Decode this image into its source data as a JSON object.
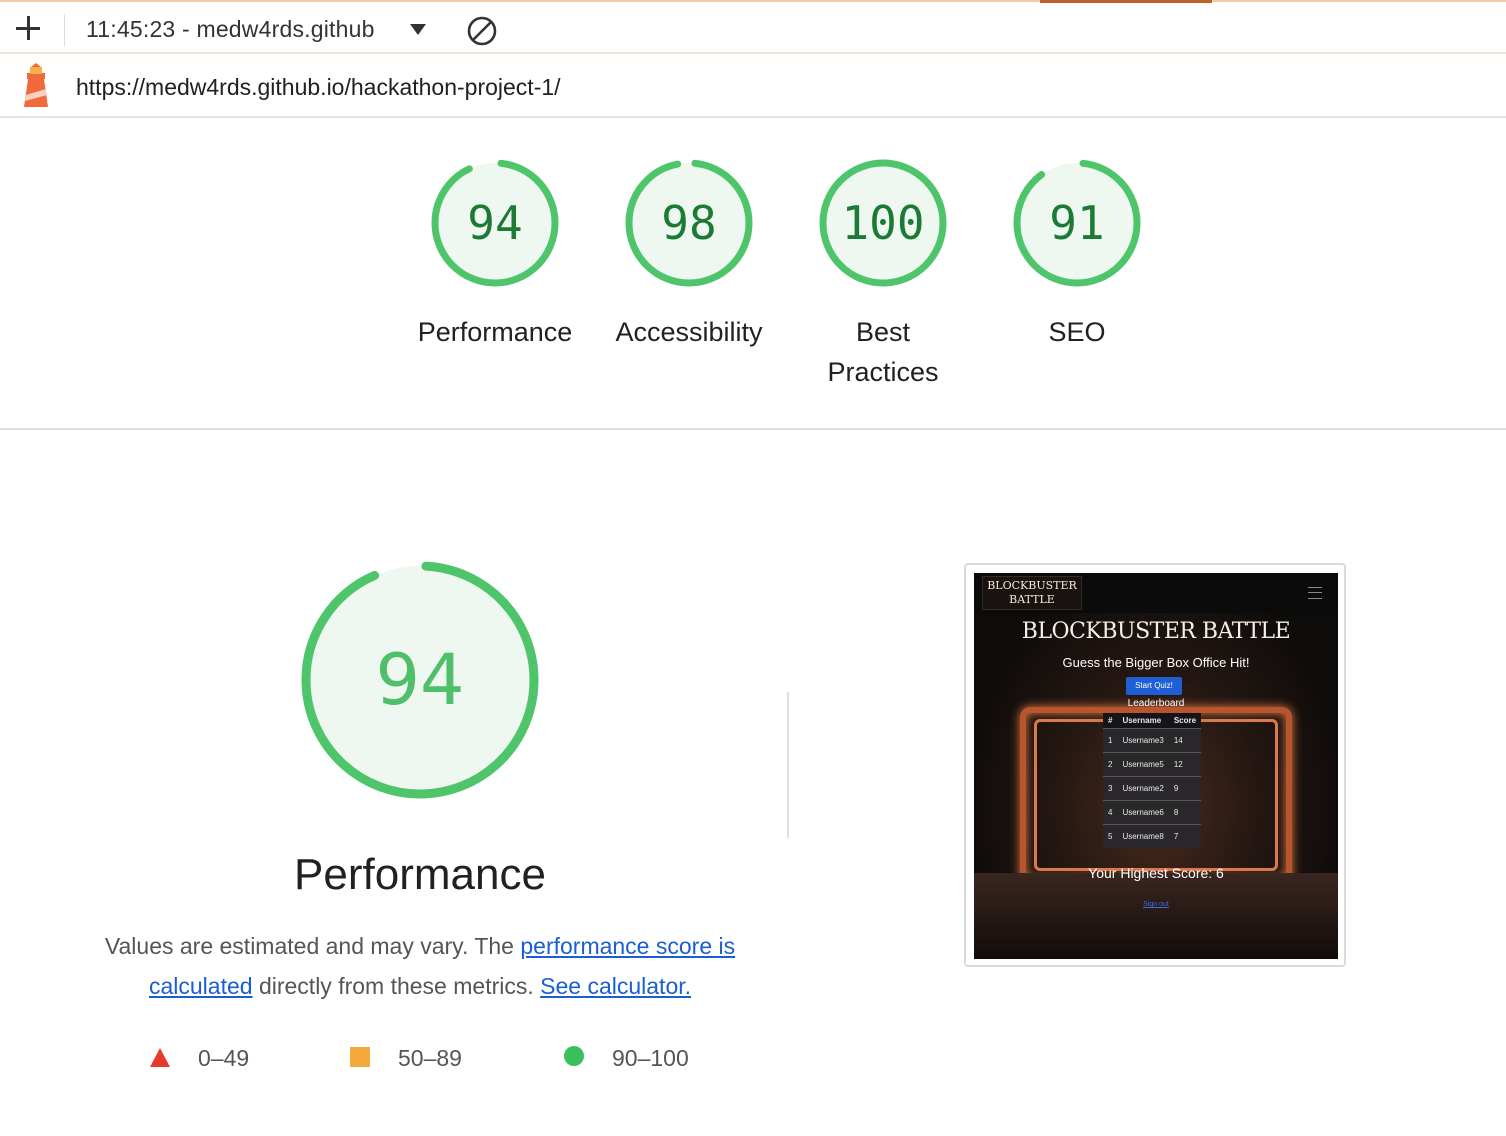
{
  "toolbar": {
    "title": "11:45:23 - medw4rds.github"
  },
  "url": "https://medw4rds.github.io/hackathon-project-1/",
  "colors": {
    "pass": "#0cce6b",
    "average": "#ffa400",
    "fail": "#ff4e42"
  },
  "scores": [
    {
      "value": "94",
      "label": "Performance",
      "score": 94
    },
    {
      "value": "98",
      "label": "Accessibility",
      "score": 98
    },
    {
      "value": "100",
      "label": "Best Practices",
      "score": 100
    },
    {
      "value": "91",
      "label": "SEO",
      "score": 91
    }
  ],
  "performance": {
    "score": "94",
    "title": "Performance",
    "desc_prefix": "Values are estimated and may vary. The ",
    "link_score": "performance score is calculated",
    "desc_middle": " directly from these metrics. ",
    "link_calculator": "See calculator."
  },
  "legend": [
    {
      "shape": "triangle",
      "range": "0–49"
    },
    {
      "shape": "square",
      "range": "50–89"
    },
    {
      "shape": "circle",
      "range": "90–100"
    }
  ],
  "screenshot": {
    "logo_line1": "BLOCKBUSTER",
    "logo_line2": "BATTLE",
    "heading": "BLOCKBUSTER BATTLE",
    "subheading": "Guess the Bigger Box Office Hit!",
    "button": "Start Quiz!",
    "leaderboard_title": "Leaderboard",
    "columns": [
      "#",
      "Username",
      "Score"
    ],
    "rows": [
      [
        "1",
        "Username3",
        "14"
      ],
      [
        "2",
        "Username5",
        "12"
      ],
      [
        "3",
        "Username2",
        "9"
      ],
      [
        "4",
        "Username6",
        "8"
      ],
      [
        "5",
        "Username8",
        "7"
      ]
    ],
    "highest_score": "Your Highest Score: 6",
    "signout": "Sign out"
  }
}
